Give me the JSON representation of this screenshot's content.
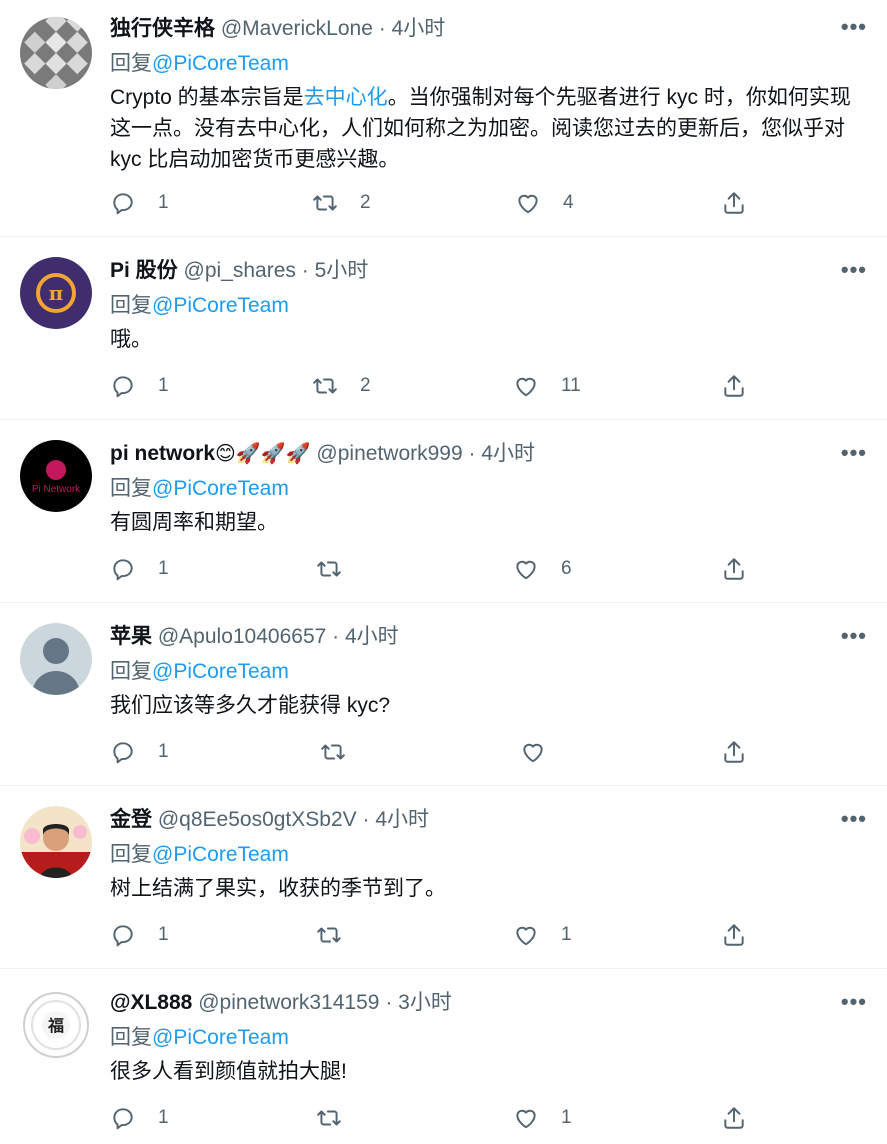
{
  "ui": {
    "more_label": "•••",
    "reply_prefix": "回复",
    "sep": "·"
  },
  "tweets": [
    {
      "name": "独行侠辛格",
      "handle": "@MaverickLone",
      "time": "4小时",
      "reply_to": "@PiCoreTeam",
      "text_before": "Crypto 的基本宗旨是",
      "text_link": "去中心化",
      "text_after": "。当你强制对每个先驱者进行 kyc 时，你如何实现这一点。没有去中心化，人们如何称之为加密。阅读您过去的更新后，您似乎对 kyc 比启动加密货币更感兴趣。",
      "replies": "1",
      "retweets": "2",
      "likes": "4"
    },
    {
      "name": "Pi 股份",
      "handle": "@pi_shares",
      "time": "5小时",
      "reply_to": "@PiCoreTeam",
      "text": "哦。",
      "replies": "1",
      "retweets": "2",
      "likes": "11"
    },
    {
      "name": "pi network",
      "name_emojis": "😊🚀🚀🚀",
      "handle": "@pinetwork999",
      "time": "4小时",
      "reply_to": "@PiCoreTeam",
      "text": "有圆周率和期望。",
      "replies": "1",
      "retweets": "",
      "likes": "6"
    },
    {
      "name": "苹果",
      "handle": "@Apulo10406657",
      "time": "4小时",
      "reply_to": "@PiCoreTeam",
      "text": "我们应该等多久才能获得 kyc?",
      "replies": "1",
      "retweets": "",
      "likes": ""
    },
    {
      "name": "金登",
      "handle": "@q8Ee5os0gtXSb2V",
      "time": "4小时",
      "reply_to": "@PiCoreTeam",
      "text": "树上结满了果实，收获的季节到了。",
      "replies": "1",
      "retweets": "",
      "likes": "1"
    },
    {
      "name": "@XL888",
      "handle": "@pinetwork314159",
      "time": "3小时",
      "reply_to": "@PiCoreTeam",
      "text": "很多人看到颜值就拍大腿!",
      "replies": "1",
      "retweets": "",
      "likes": "1"
    }
  ],
  "colors": {
    "link": "#1d9bf0",
    "muted": "#536471",
    "text": "#0f1419",
    "divider": "#eff3f4"
  },
  "icons": [
    "reply-icon",
    "retweet-icon",
    "like-icon",
    "share-icon",
    "more-icon"
  ]
}
